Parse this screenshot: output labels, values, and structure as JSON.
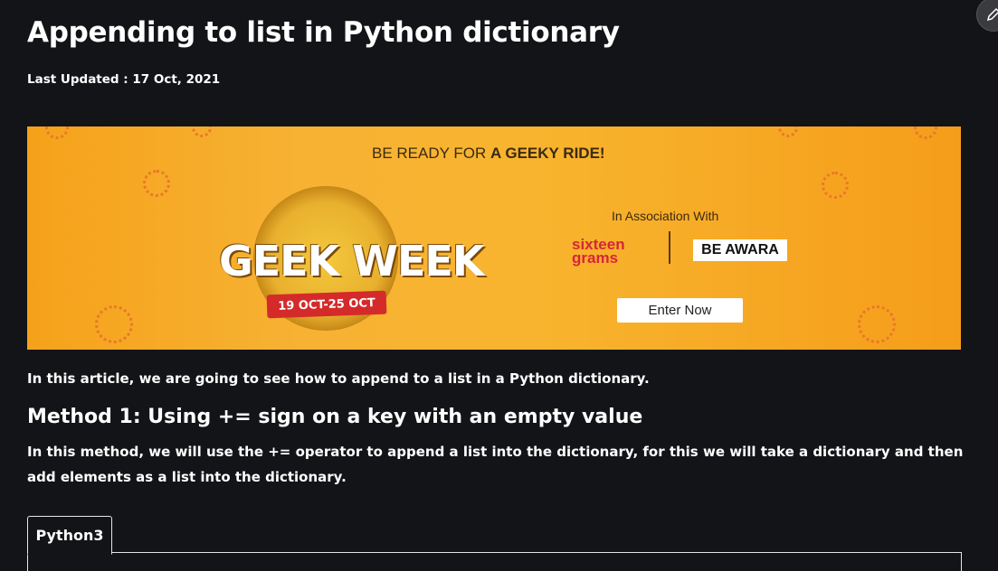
{
  "article": {
    "title": "Appending to list in Python dictionary",
    "last_updated": "Last Updated : 17 Oct, 2021",
    "intro": "In this article, we are going to see how to append to a list in a Python dictionary.",
    "method1_heading": "Method 1: Using += sign on a key with an empty value",
    "method1_text": "In this method, we will use the += operator to append a list into the dictionary, for this we will take a dictionary and then add elements as a list into the dictionary."
  },
  "banner": {
    "headline_plain": "BE READY FOR ",
    "headline_bold": "A GEEKY RIDE!",
    "logo_text": "GEEK WEEK",
    "dates": "19 OCT-25 OCT",
    "association": "In Association With",
    "brand1": "sixteen grams",
    "brand2": "BE AWARA",
    "cta": "Enter Now"
  },
  "code_tabs": [
    {
      "label": "Python3"
    }
  ],
  "icons": {
    "edit": "pencil-icon"
  },
  "colors": {
    "background": "#131417",
    "banner": "#f8b42e",
    "accent_red": "#d42a2a"
  }
}
